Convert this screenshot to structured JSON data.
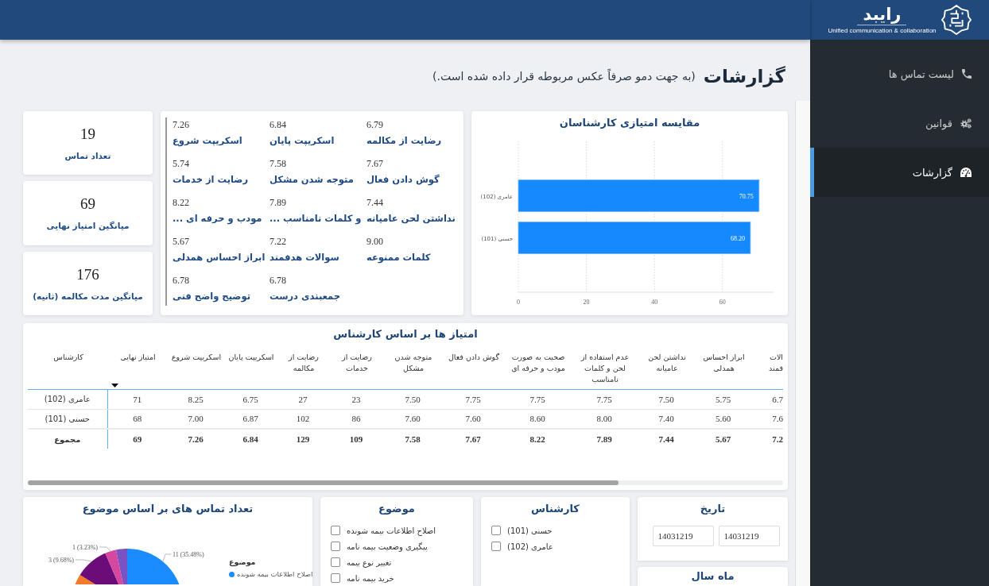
{
  "header": {
    "logo": {
      "name": "رایبد",
      "tagline": "Unified communication & collaboration"
    }
  },
  "sidebar": {
    "items": [
      {
        "label": "لیست تماس ها",
        "selected": false
      },
      {
        "label": "قوانین",
        "selected": false
      },
      {
        "label": "گزارشات",
        "selected": true
      }
    ]
  },
  "page": {
    "title": "گزارشات",
    "subtitle": "(به جهت دمو صرفاً عکس مربوطه قرار داده شده است.)"
  },
  "bar_chart": {
    "chart_data": {
      "type": "bar",
      "orientation": "horizontal",
      "title": "مقایسه امتیازی کارشناسان",
      "categories": [
        "عامری (102)",
        "حسنی (101)"
      ],
      "series": [
        {
          "color": "#1589ff",
          "values": [
            70.75,
            68.2
          ]
        }
      ],
      "xlim": [
        0,
        75
      ],
      "xticks": [
        0,
        20,
        40,
        60
      ],
      "grid": true,
      "value_labels": [
        "70.75",
        "68.20"
      ]
    }
  },
  "scores": {
    "items": [
      {
        "value": "6.79",
        "label": "رضایت از مکالمه"
      },
      {
        "value": "6.84",
        "label": "اسکریپت پایان"
      },
      {
        "value": "7.26",
        "label": "اسکریپت شروع"
      },
      {
        "value": "7.67",
        "label": "گوش دادن فعال"
      },
      {
        "value": "7.58",
        "label": "متوجه شدن مشکل"
      },
      {
        "value": "5.74",
        "label": "رضایت از خدمات"
      },
      {
        "value": "7.44",
        "label": "نداشتن لحن عامیانه"
      },
      {
        "value": "7.89",
        "label": "و کلمات نامناسب ..."
      },
      {
        "value": "8.22",
        "label": "مودب و حرفه ای ..."
      },
      {
        "value": "9.00",
        "label": "کلمات ممنوعه"
      },
      {
        "value": "7.22",
        "label": "سوالات هدفمند"
      },
      {
        "value": "5.67",
        "label": "ابراز احساس همدلی"
      },
      {
        "value": "6.78",
        "label": "جمعبندی درست"
      },
      {
        "value": "6.78",
        "label": "توضیح واضح فنی"
      }
    ]
  },
  "kpis": [
    {
      "value": "19",
      "label": "تعداد تماس"
    },
    {
      "value": "69",
      "label": "میانگین امتیاز نهایی"
    },
    {
      "value": "176",
      "label": "میانگین مدت مکالمه (ثانیه)"
    }
  ],
  "table": {
    "title": "امتیاز ها بر اساس کارشناس",
    "columns": [
      {
        "label": "الات فمند",
        "sorted": false
      },
      {
        "label": "ابراز احساس همدلی",
        "sorted": false
      },
      {
        "label": "نداشتن لحن عامیانه",
        "sorted": false
      },
      {
        "label": "عدم استفاده از لحن و کلمات نامناسب",
        "sorted": false
      },
      {
        "label": "صحبت به صورت مودب و حرفه ای",
        "sorted": false
      },
      {
        "label": "گوش دادن فعال",
        "sorted": false
      },
      {
        "label": "متوجه شدن مشکل",
        "sorted": false
      },
      {
        "label": "رضایت از خدمات",
        "sorted": false
      },
      {
        "label": "رضایت از مکالمه",
        "sorted": false
      },
      {
        "label": "اسکریپت پایان",
        "sorted": false
      },
      {
        "label": "اسکریپت شروع",
        "sorted": false
      },
      {
        "label": "امتیاز نهایی",
        "sorted": true
      },
      {
        "label": "کارشناس",
        "sorted": false
      }
    ],
    "rows": [
      {
        "cells": [
          "6.7",
          "5.75",
          "7.50",
          "7.75",
          "7.75",
          "7.75",
          "7.50",
          "23",
          "27",
          "6.75",
          "8.25",
          "71",
          "عامری (102)"
        ]
      },
      {
        "cells": [
          "7.6",
          "5.60",
          "7.40",
          "8.00",
          "8.60",
          "7.60",
          "7.60",
          "86",
          "102",
          "6.87",
          "7.00",
          "68",
          "حسنی (101)"
        ]
      }
    ],
    "total": {
      "cells": [
        "7.2",
        "5.67",
        "7.44",
        "7.89",
        "8.22",
        "7.67",
        "7.58",
        "109",
        "129",
        "6.84",
        "7.26",
        "69",
        "مجموع"
      ]
    }
  },
  "date_filter": {
    "title": "تاریخ",
    "fields": [
      {
        "value": "14031219"
      },
      {
        "value": "14031219"
      }
    ]
  },
  "month_filter": {
    "title": "ماه سال"
  },
  "expert_filter": {
    "title": "کارشناس",
    "options": [
      {
        "label": "حسنی (101)",
        "checked": false
      },
      {
        "label": "عامری (102)",
        "checked": false
      }
    ]
  },
  "topic_filter": {
    "title": "موضوع",
    "options": [
      {
        "label": "اصلاح اطلاعات بیمه شونده",
        "checked": false
      },
      {
        "label": "پیگیری وضعیت بیمه نامه",
        "checked": false
      },
      {
        "label": "تغییر نوع بیمه",
        "checked": false
      },
      {
        "label": "خرید بیمه نامه",
        "checked": false
      }
    ]
  },
  "topic_chart": {
    "title": "تعداد تماس های بر اساس موضوع",
    "slices": [
      {
        "color": "#1a8cff",
        "label": "11 (35.48%)"
      },
      {
        "color": "#f27a2a"
      },
      {
        "color": "#6c0c78",
        "label": "3 (9.68%)"
      },
      {
        "color": "#d6479f",
        "label": "1 (3.23%)"
      },
      {
        "color": "#7b52c1"
      }
    ],
    "legend": {
      "title": "موضوع",
      "items": [
        {
          "label": "اصلاح اطلاعات بیمه شونده",
          "color": "#1a8cff"
        }
      ]
    }
  }
}
